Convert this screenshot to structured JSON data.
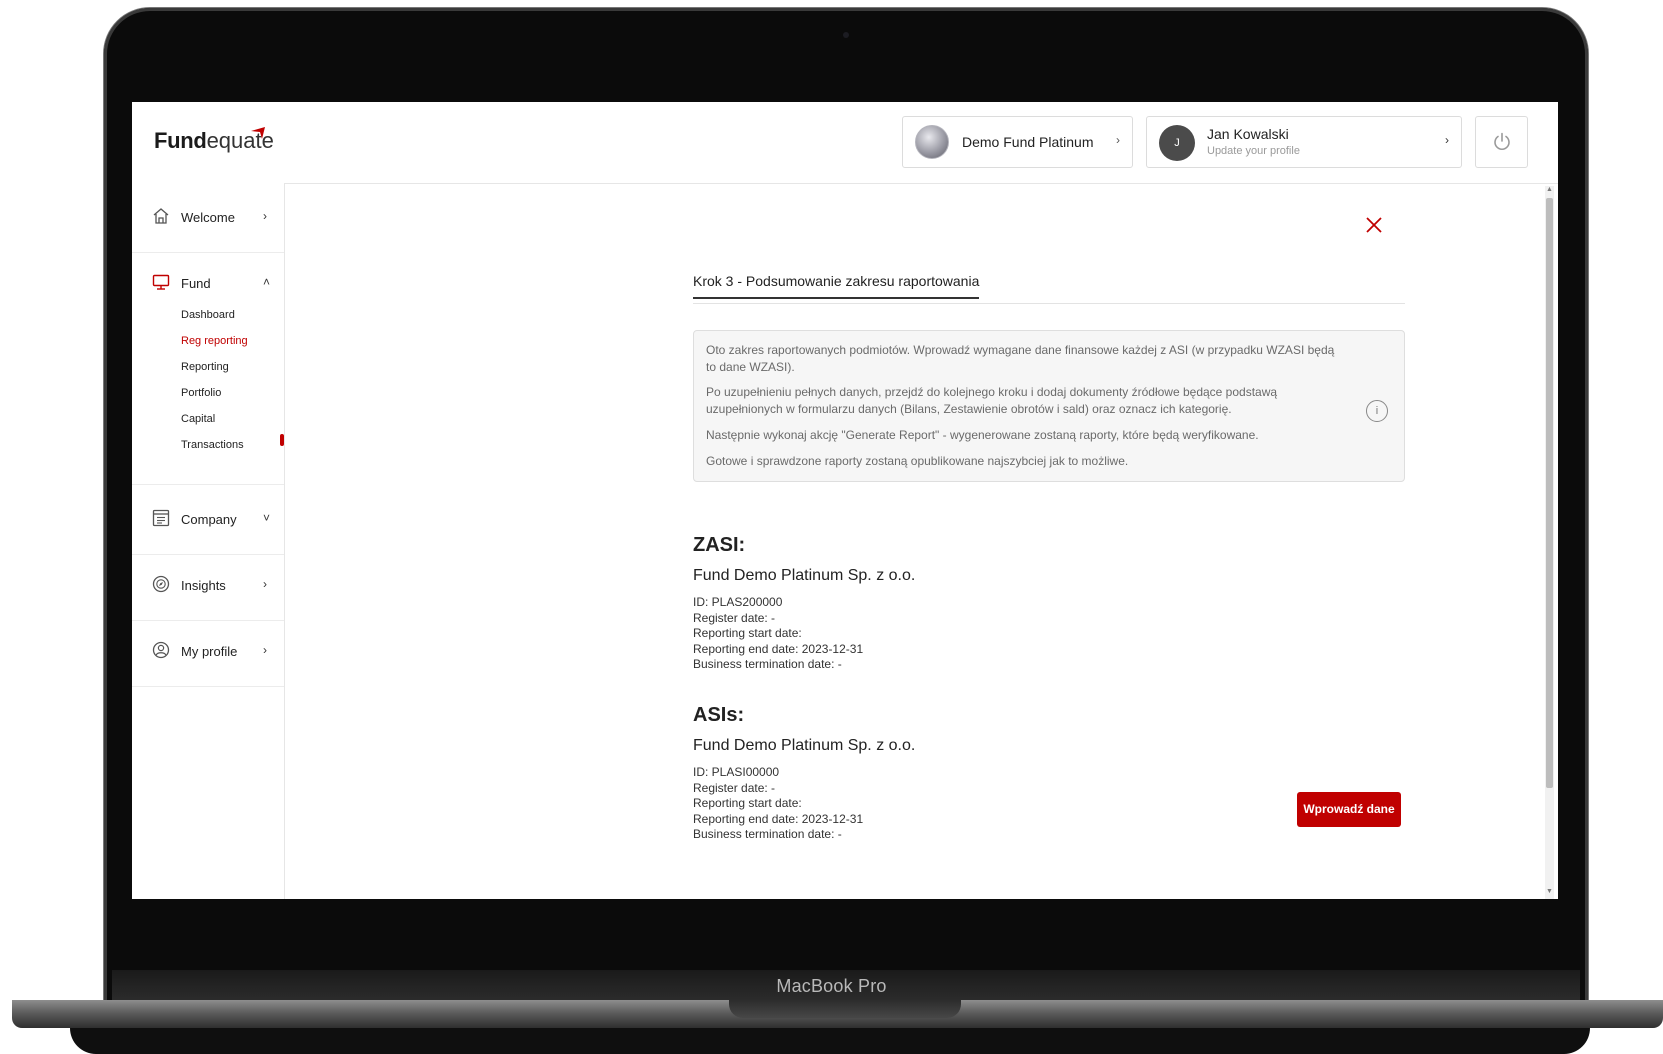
{
  "device": {
    "brand_label": "MacBook Pro"
  },
  "header": {
    "logo_bold": "Fund",
    "logo_light": "equate",
    "fund_selector": {
      "name": "Demo Fund Platinum"
    },
    "user": {
      "initial": "J",
      "name": "Jan Kowalski",
      "subtitle": "Update your profile"
    }
  },
  "sidebar": {
    "items": [
      {
        "label": "Welcome",
        "icon": "home-icon",
        "chevron": "›"
      },
      {
        "label": "Fund",
        "icon": "monitor-icon",
        "chevron": "˄"
      },
      {
        "label": "Company",
        "icon": "building-icon",
        "chevron": "˅"
      },
      {
        "label": "Insights",
        "icon": "compass-icon",
        "chevron": "›"
      },
      {
        "label": "My profile",
        "icon": "user-icon",
        "chevron": "›"
      }
    ],
    "fund_subitems": [
      "Dashboard",
      "Reg reporting",
      "Reporting",
      "Portfolio",
      "Capital",
      "Transactions"
    ],
    "active_subitem": "Reg reporting"
  },
  "main": {
    "step_title": "Krok 3 - Podsumowanie zakresu raportowania",
    "info_paragraphs": [
      "Oto zakres raportowanych podmiotów. Wprowadź wymagane dane finansowe każdej z ASI (w przypadku WZASI będą to dane WZASI).",
      "Po uzupełnieniu pełnych danych, przejdź do kolejnego kroku i dodaj dokumenty źródłowe będące podstawą uzupełnionych w formularzu danych (Bilans, Zestawienie obrotów i sald) oraz oznacz ich kategorię.",
      "Następnie wykonaj akcję \"Generate Report\" - wygenerowane zostaną raporty, które będą weryfikowane.",
      "Gotowe i sprawdzone raporty zostaną opublikowane najszybciej jak to możliwe."
    ],
    "info_icon": "i",
    "zasi": {
      "title": "ZASI:",
      "entity": "Fund Demo Platinum Sp. z o.o.",
      "details": [
        "ID: PLAS200000",
        "Register date: -",
        "Reporting start date:",
        "Reporting end date: 2023-12-31",
        "Business termination date: -"
      ]
    },
    "asis": {
      "title": "ASIs:",
      "entity": "Fund Demo Platinum Sp. z o.o.",
      "details": [
        "ID: PLASI00000",
        "Register date: -",
        "Reporting start date:",
        "Reporting end date: 2023-12-31",
        "Business termination date: -"
      ],
      "button_label": "Wprowadź dane"
    }
  },
  "colors": {
    "accent": "#c00000",
    "text": "#222222",
    "muted": "#6a6a6a"
  }
}
